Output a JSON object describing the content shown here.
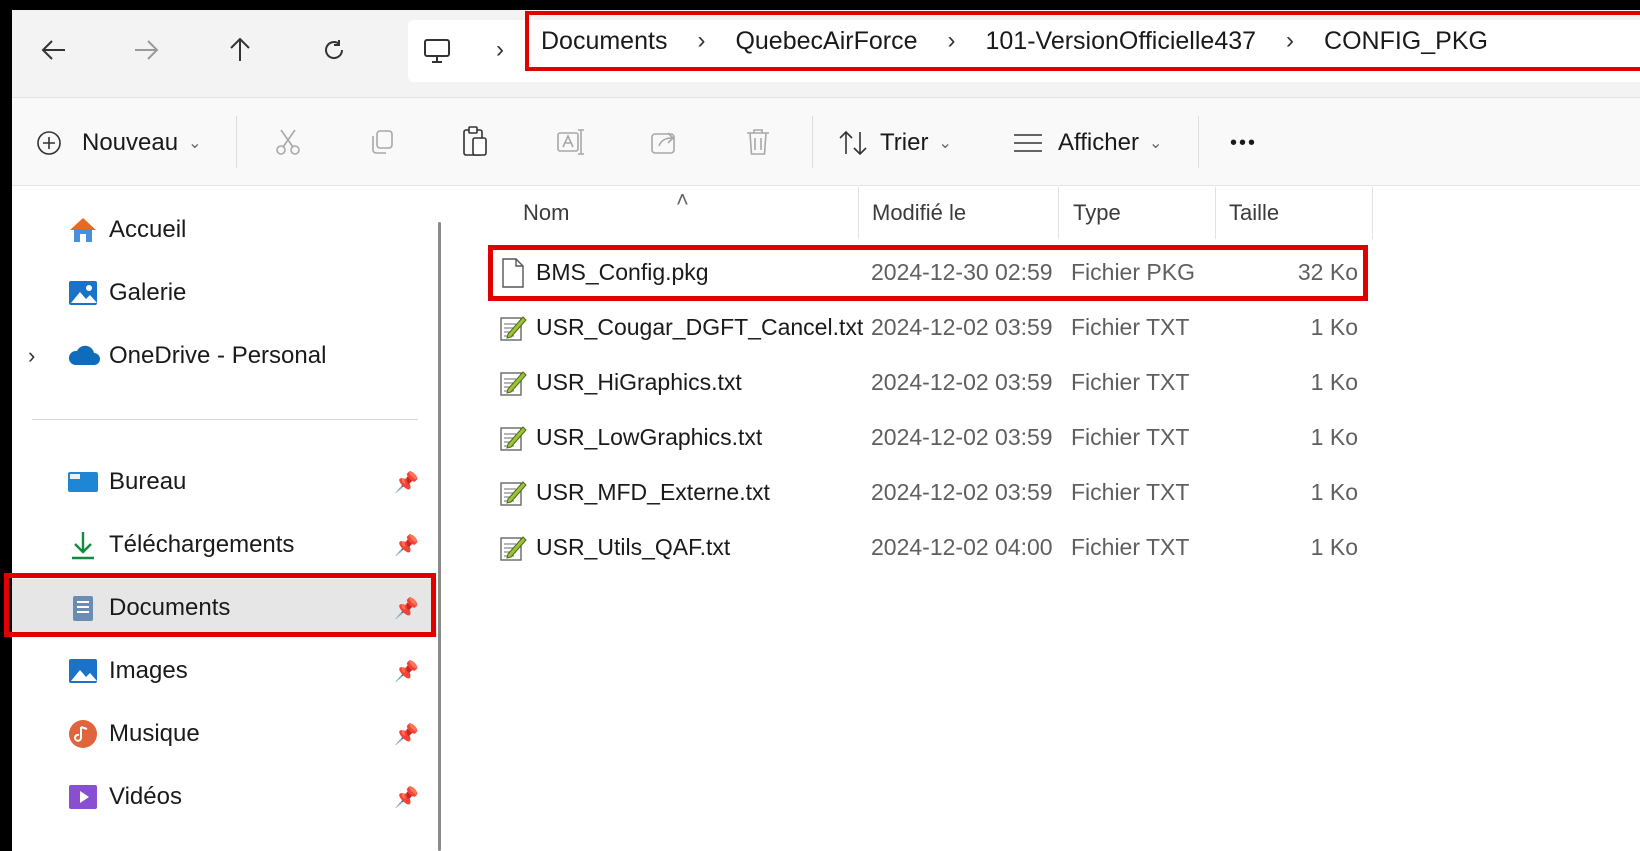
{
  "breadcrumb": [
    "Documents",
    "QuebecAirForce",
    "101-VersionOfficielle437",
    "CONFIG_PKG"
  ],
  "toolbar": {
    "new_label": "Nouveau",
    "sort_label": "Trier",
    "view_label": "Afficher",
    "more_label": "•••"
  },
  "sidebar": {
    "top_items": [
      {
        "label": "Accueil",
        "icon": "home-icon"
      },
      {
        "label": "Galerie",
        "icon": "gallery-icon"
      },
      {
        "label": "OneDrive - Personal",
        "icon": "cloud-icon"
      }
    ],
    "pinned_items": [
      {
        "label": "Bureau",
        "icon": "desktop-icon"
      },
      {
        "label": "Téléchargements",
        "icon": "download-icon"
      },
      {
        "label": "Documents",
        "icon": "documents-icon"
      },
      {
        "label": "Images",
        "icon": "images-icon"
      },
      {
        "label": "Musique",
        "icon": "music-icon"
      },
      {
        "label": "Vidéos",
        "icon": "videos-icon"
      }
    ],
    "selected": "Documents"
  },
  "columns": {
    "name": "Nom",
    "modified": "Modifié le",
    "type": "Type",
    "size": "Taille"
  },
  "files": [
    {
      "name": "BMS_Config.pkg",
      "modified": "2024-12-30 02:59",
      "type": "Fichier PKG",
      "size": "32 Ko",
      "icon": "blank-file-icon"
    },
    {
      "name": "USR_Cougar_DGFT_Cancel.txt",
      "modified": "2024-12-02 03:59",
      "type": "Fichier TXT",
      "size": "1 Ko",
      "icon": "text-file-icon"
    },
    {
      "name": "USR_HiGraphics.txt",
      "modified": "2024-12-02 03:59",
      "type": "Fichier TXT",
      "size": "1 Ko",
      "icon": "text-file-icon"
    },
    {
      "name": "USR_LowGraphics.txt",
      "modified": "2024-12-02 03:59",
      "type": "Fichier TXT",
      "size": "1 Ko",
      "icon": "text-file-icon"
    },
    {
      "name": "USR_MFD_Externe.txt",
      "modified": "2024-12-02 03:59",
      "type": "Fichier TXT",
      "size": "1 Ko",
      "icon": "text-file-icon"
    },
    {
      "name": "USR_Utils_QAF.txt",
      "modified": "2024-12-02 04:00",
      "type": "Fichier TXT",
      "size": "1 Ko",
      "icon": "text-file-icon"
    }
  ],
  "colors": {
    "highlight": "#e00000",
    "selected_bg": "#e6e6e6"
  }
}
